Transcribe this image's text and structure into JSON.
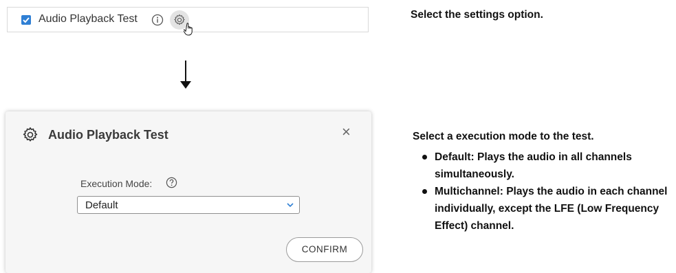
{
  "top_row": {
    "checkbox_checked": true,
    "test_name": "Audio Playback Test",
    "info_icon": "info-icon",
    "settings_icon": "gear-icon"
  },
  "instructions": {
    "step1": "Select the settings option.",
    "step2": "Select a execution mode to the test.",
    "bullets": [
      "Default: Plays the audio in all channels simultaneously.",
      "Multichannel: Plays the audio in each channel individually, except the LFE (Low Frequency Effect) channel."
    ]
  },
  "dialog": {
    "title": "Audio Playback Test",
    "close_label": "×",
    "execution_mode_label": "Execution Mode:",
    "execution_mode_value": "Default",
    "confirm_label": "CONFIRM"
  },
  "colors": {
    "checkbox": "#2f7fd4",
    "dialog_bg": "#f6f6f6"
  }
}
